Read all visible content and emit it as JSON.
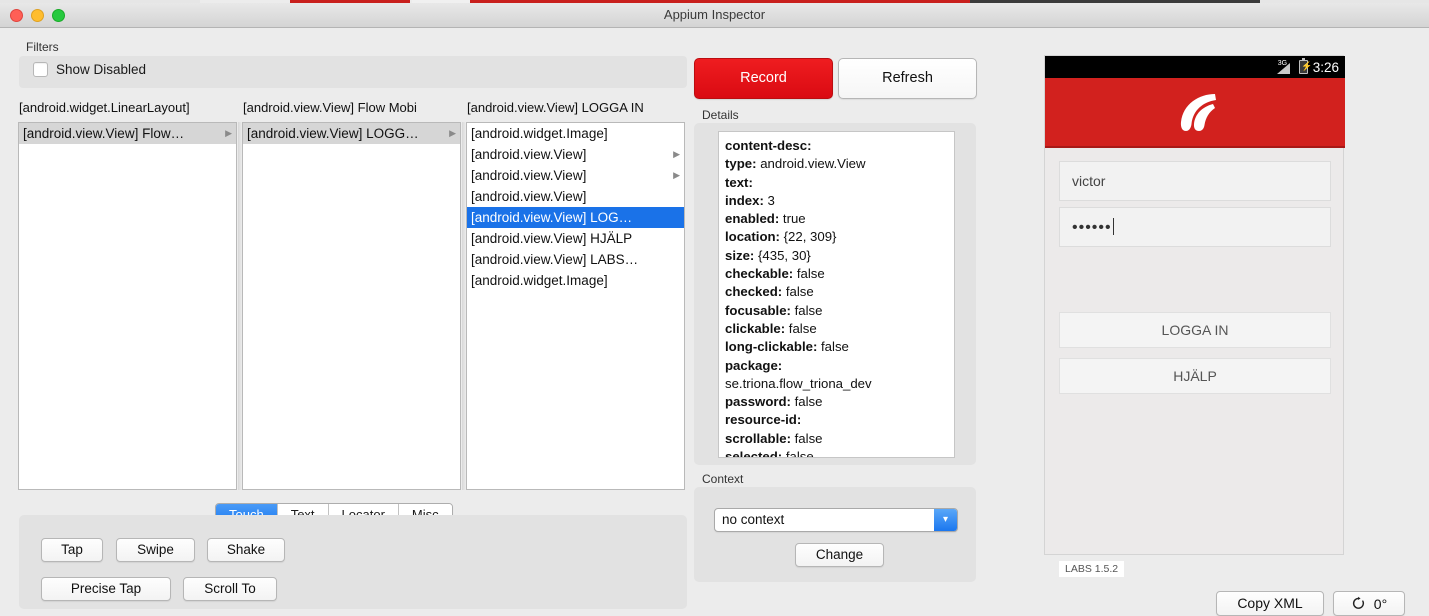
{
  "window": {
    "title": "Appium Inspector"
  },
  "traffic_lights": [
    {
      "name": "close",
      "color": "#ff5f56"
    },
    {
      "name": "minimize",
      "color": "#ffbd2e"
    },
    {
      "name": "zoom",
      "color": "#27c93f"
    }
  ],
  "filters": {
    "label": "Filters",
    "show_disabled_label": "Show Disabled",
    "show_disabled_checked": false
  },
  "browser": {
    "columns": [
      {
        "header": "[android.widget.LinearLayout]",
        "rows": [
          {
            "label": "[android.view.View] Flow…",
            "has_children": true,
            "selected": "gray"
          }
        ]
      },
      {
        "header": "[android.view.View] Flow Mobi",
        "rows": [
          {
            "label": "[android.view.View] LOGG…",
            "has_children": true,
            "selected": "gray"
          }
        ]
      },
      {
        "header": "[android.view.View] LOGGA IN",
        "rows": [
          {
            "label": "[android.widget.Image]",
            "has_children": false,
            "selected": "none"
          },
          {
            "label": "[android.view.View]",
            "has_children": true,
            "selected": "none"
          },
          {
            "label": "[android.view.View]",
            "has_children": true,
            "selected": "none"
          },
          {
            "label": "[android.view.View]",
            "has_children": false,
            "selected": "none"
          },
          {
            "label": "[android.view.View] LOG…",
            "has_children": false,
            "selected": "blue"
          },
          {
            "label": "[android.view.View] HJÄLP",
            "has_children": false,
            "selected": "none"
          },
          {
            "label": "[android.view.View] LABS…",
            "has_children": false,
            "selected": "none"
          },
          {
            "label": "[android.widget.Image]",
            "has_children": false,
            "selected": "none"
          }
        ]
      }
    ]
  },
  "tabs": [
    {
      "label": "Touch",
      "active": true
    },
    {
      "label": "Text",
      "active": false
    },
    {
      "label": "Locator",
      "active": false
    },
    {
      "label": "Misc",
      "active": false
    }
  ],
  "actions": {
    "tap": "Tap",
    "swipe": "Swipe",
    "shake": "Shake",
    "precise_tap": "Precise Tap",
    "scroll_to": "Scroll To"
  },
  "toolbar": {
    "record": "Record",
    "refresh": "Refresh",
    "record_color": "#da0a12"
  },
  "details": {
    "label": "Details",
    "rows": [
      {
        "key": "content-desc:",
        "value": ""
      },
      {
        "key": "type:",
        "value": "android.view.View"
      },
      {
        "key": "text:",
        "value": ""
      },
      {
        "key": "index:",
        "value": "3"
      },
      {
        "key": "enabled:",
        "value": "true"
      },
      {
        "key": "location:",
        "value": "{22, 309}"
      },
      {
        "key": "size:",
        "value": "{435, 30}"
      },
      {
        "key": "checkable:",
        "value": "false"
      },
      {
        "key": "checked:",
        "value": "false"
      },
      {
        "key": "focusable:",
        "value": "false"
      },
      {
        "key": "clickable:",
        "value": "false"
      },
      {
        "key": "long-clickable:",
        "value": "false"
      },
      {
        "key": "package:",
        "value": ""
      },
      {
        "key": "",
        "value": "se.triona.flow_triona_dev"
      },
      {
        "key": "password:",
        "value": "false"
      },
      {
        "key": "resource-id:",
        "value": ""
      },
      {
        "key": "scrollable:",
        "value": "false"
      },
      {
        "key": "selected:",
        "value": "false"
      }
    ]
  },
  "context": {
    "label": "Context",
    "selected": "no context",
    "change_label": "Change"
  },
  "device": {
    "status": {
      "network": "3G",
      "clock": "3:26"
    },
    "header_color": "#d2211e",
    "username": "victor",
    "password_dots": "••••••",
    "login_label": "LOGGA IN",
    "help_label": "HJÄLP",
    "version": "LABS 1.5.2"
  },
  "footer": {
    "copy_xml": "Copy XML",
    "rotation": "0°"
  }
}
